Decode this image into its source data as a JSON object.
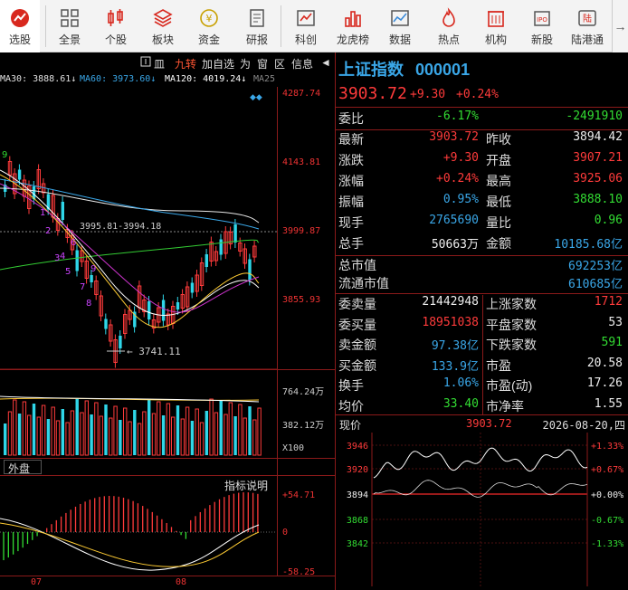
{
  "toolbar": {
    "items": [
      {
        "label": "选股",
        "icon": "stock-pick-icon",
        "active": true
      },
      {
        "label": "全景",
        "icon": "grid-icon"
      },
      {
        "label": "个股",
        "icon": "candlestick-icon"
      },
      {
        "label": "板块",
        "icon": "layers-icon"
      },
      {
        "label": "资金",
        "icon": "yen-coin-icon"
      },
      {
        "label": "研报",
        "icon": "report-icon"
      },
      {
        "label": "科创",
        "icon": "chart-board-icon"
      },
      {
        "label": "龙虎榜",
        "icon": "bar-podium-icon"
      },
      {
        "label": "数据",
        "icon": "line-chart-icon"
      },
      {
        "label": "热点",
        "icon": "flame-icon"
      },
      {
        "label": "机构",
        "icon": "building-icon"
      },
      {
        "label": "新股",
        "icon": "ipo-icon"
      },
      {
        "label": "陆港通",
        "icon": "hk-connect-icon"
      }
    ],
    "more_arrow": "→"
  },
  "chart_controls": {
    "items": [
      "皿",
      "九转",
      "加自选",
      "为",
      "窗",
      "区",
      "信息"
    ],
    "expand": "◄"
  },
  "ma_line": {
    "ma30": "MA30: 3888.61↓",
    "ma60": "MA60: 3973.60↓",
    "ma120": "MA120: 4019.24↓",
    "ma250": "MA25"
  },
  "price_axis": [
    "4287.74",
    "4143.81",
    "3999.87",
    "3855.93"
  ],
  "annotations": {
    "range_label": "3995.81-3994.18",
    "low_label": "3741.11",
    "nine_turn_marks": [
      "9",
      "1",
      "2",
      "3",
      "4",
      "5",
      "6",
      "7",
      "8",
      "9"
    ]
  },
  "volume_axis": [
    "764.24万",
    "382.12万",
    "X100"
  ],
  "waipan_label": "外盘",
  "indicator_label": "指标说明",
  "macd_axis": [
    "+54.71",
    "0",
    "-58.25"
  ],
  "date_axis": [
    "07",
    "08"
  ],
  "quote": {
    "name": "上证指数",
    "code": "000001",
    "price": "3903.72",
    "change": "+9.30",
    "change_pct": "+0.24%",
    "webi": {
      "label": "委比",
      "pct": "-6.17%",
      "diff": "-2491910"
    },
    "rows": [
      {
        "l1": "最新",
        "v1": "3903.72",
        "c1": "red",
        "l2": "昨收",
        "v2": "3894.42",
        "c2": "white"
      },
      {
        "l1": "涨跌",
        "v1": "+9.30",
        "c1": "red",
        "l2": "开盘",
        "v2": "3907.21",
        "c2": "red"
      },
      {
        "l1": "涨幅",
        "v1": "+0.24%",
        "c1": "red",
        "l2": "最高",
        "v2": "3925.06",
        "c2": "red"
      },
      {
        "l1": "振幅",
        "v1": "0.95%",
        "c1": "cyan",
        "l2": "最低",
        "v2": "3888.10",
        "c2": "green"
      },
      {
        "l1": "现手",
        "v1": "2765690",
        "c1": "cyan",
        "l2": "量比",
        "v2": "0.96",
        "c2": "green"
      },
      {
        "l1": "总手",
        "v1": "50663万",
        "c1": "white",
        "l2": "金额",
        "v2": "10185.68亿",
        "c2": "cyan"
      }
    ],
    "market_cap": [
      {
        "label": "总市值",
        "value": "692253亿"
      },
      {
        "label": "流通市值",
        "value": "610685亿"
      }
    ],
    "stats": [
      {
        "l1": "委卖量",
        "v1": "21442948",
        "c1": "white",
        "l2": "上涨家数",
        "v2": "1712",
        "c2": "red"
      },
      {
        "l1": "委买量",
        "v1": "18951038",
        "c1": "red",
        "l2": "平盘家数",
        "v2": "53",
        "c2": "white"
      },
      {
        "l1": "卖金额",
        "v1": "97.38亿",
        "c1": "cyan",
        "l2": "下跌家数",
        "v2": "591",
        "c2": "green"
      },
      {
        "l1": "买金额",
        "v1": "133.9亿",
        "c1": "cyan",
        "l2": "市盈",
        "v2": "20.58",
        "c2": "white"
      },
      {
        "l1": "换手",
        "v1": "1.06%",
        "c1": "cyan",
        "l2": "市盈(动)",
        "v2": "17.26",
        "c2": "white"
      },
      {
        "l1": "均价",
        "v1": "33.40",
        "c1": "green",
        "l2": "市净率",
        "v2": "1.55",
        "c2": "white"
      }
    ]
  },
  "mini_chart": {
    "label": "现价",
    "price": "3903.72",
    "date": "2026-08-20,四",
    "left_axis": [
      "3946",
      "3920",
      "3894",
      "3868",
      "3842"
    ],
    "right_axis": [
      "+1.33%",
      "+0.67%",
      "+0.00%",
      "-0.67%",
      "-1.33%"
    ]
  },
  "colors": {
    "up": "#ff3b3b",
    "down": "#33dd33",
    "accent": "#3aa7e8",
    "grid": "#8b1a1a"
  }
}
